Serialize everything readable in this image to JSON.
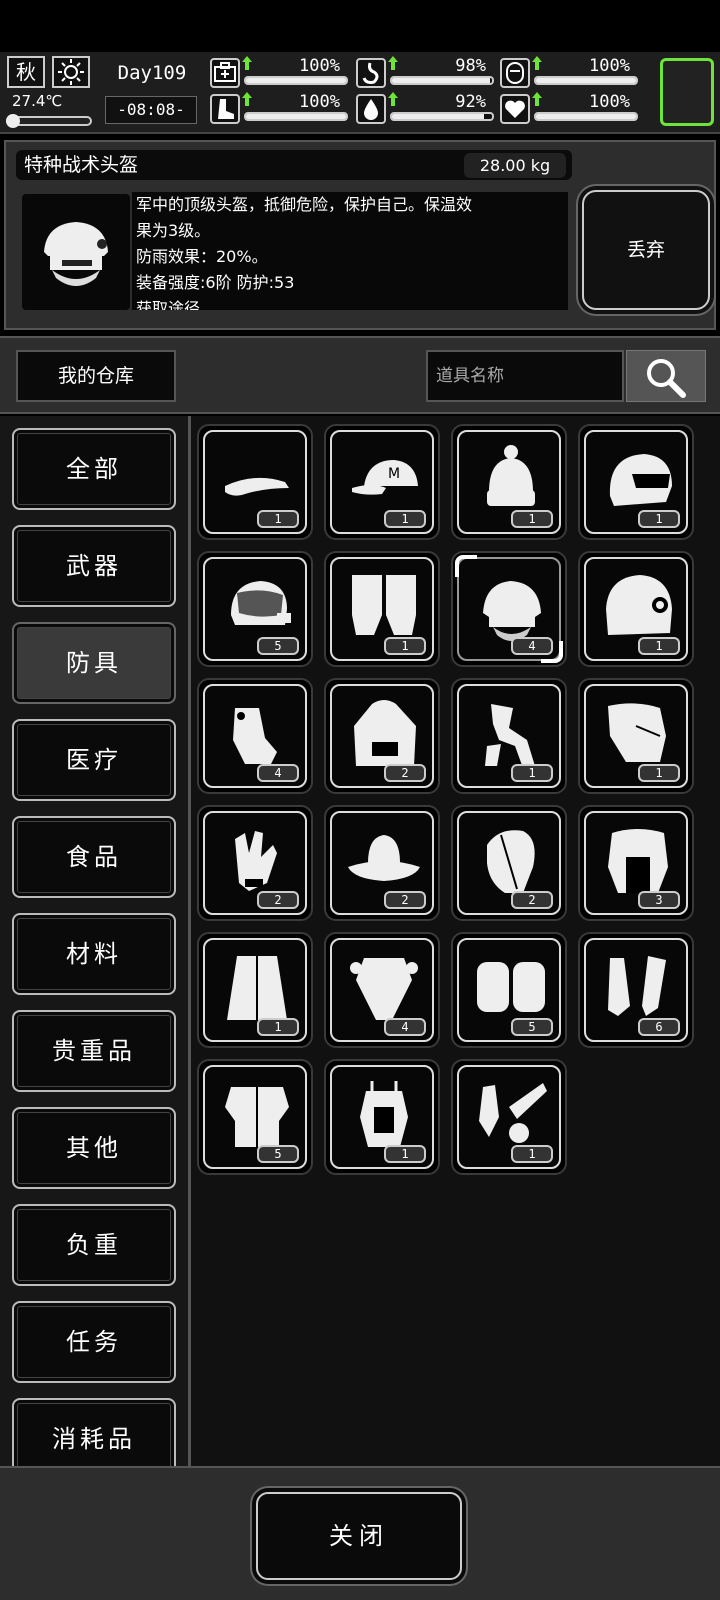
{
  "hud": {
    "season": "秋",
    "weather_icon": "sun-icon",
    "temperature": "27.4℃",
    "day": "Day109",
    "time": "-08:08-",
    "stats": [
      {
        "name": "health",
        "icon": "medkit-icon",
        "value": "100%",
        "level": 1.0
      },
      {
        "name": "hunger",
        "icon": "stomach-icon",
        "value": "98%",
        "level": 0.98
      },
      {
        "name": "mood",
        "icon": "face-icon",
        "value": "100%",
        "level": 1.0
      },
      {
        "name": "stamina",
        "icon": "boot-icon",
        "value": "100%",
        "level": 1.0
      },
      {
        "name": "thirst",
        "icon": "water-drop-icon",
        "value": "92%",
        "level": 0.92
      },
      {
        "name": "heart",
        "icon": "heart-icon",
        "value": "100%",
        "level": 1.0
      }
    ],
    "accent": "#6ee33a"
  },
  "detail": {
    "name": "特种战术头盔",
    "weight": "28.00 kg",
    "desc_lines": [
      "军中的顶级头盔，抵御危险，保护自己。保温效",
      "果为3级。",
      "防雨效果：20%。",
      "装备强度:6阶   防护:53",
      "获取途径"
    ],
    "discard_label": "丢弃"
  },
  "warehouse": {
    "title": "我的仓库",
    "search_placeholder": "道具名称"
  },
  "categories": [
    "全部",
    "武器",
    "防具",
    "医疗",
    "食品",
    "材料",
    "贵重品",
    "其他",
    "负重",
    "任务",
    "消耗品"
  ],
  "active_category": "防具",
  "items": [
    {
      "icon": "visor-cap-icon",
      "count": "1"
    },
    {
      "icon": "baseball-cap-icon",
      "count": "1"
    },
    {
      "icon": "beanie-icon",
      "count": "1"
    },
    {
      "icon": "motorcycle-helmet-icon",
      "count": "1"
    },
    {
      "icon": "riot-helmet-icon",
      "count": "5"
    },
    {
      "icon": "fingerless-gloves-icon",
      "count": "1"
    },
    {
      "icon": "tactical-helmet-icon",
      "count": "4",
      "selected": true
    },
    {
      "icon": "armored-helmet-icon",
      "count": "1"
    },
    {
      "icon": "gloves-icon",
      "count": "4"
    },
    {
      "icon": "hoodie-icon",
      "count": "2"
    },
    {
      "icon": "clothes-icon",
      "count": "1"
    },
    {
      "icon": "tactical-glove-icon",
      "count": "1"
    },
    {
      "icon": "work-glove-icon",
      "count": "2"
    },
    {
      "icon": "bucket-hat-icon",
      "count": "2"
    },
    {
      "icon": "leather-cap-icon",
      "count": "2"
    },
    {
      "icon": "fur-vest-icon",
      "count": "3"
    },
    {
      "icon": "fur-coat-icon",
      "count": "1"
    },
    {
      "icon": "body-armor-icon",
      "count": "4"
    },
    {
      "icon": "knee-pads-icon",
      "count": "5"
    },
    {
      "icon": "shin-guards-icon",
      "count": "6"
    },
    {
      "icon": "chest-armor-icon",
      "count": "5"
    },
    {
      "icon": "tactical-vest-icon",
      "count": "1"
    },
    {
      "icon": "gear-set-icon",
      "count": "1"
    }
  ],
  "close_label": "关闭"
}
